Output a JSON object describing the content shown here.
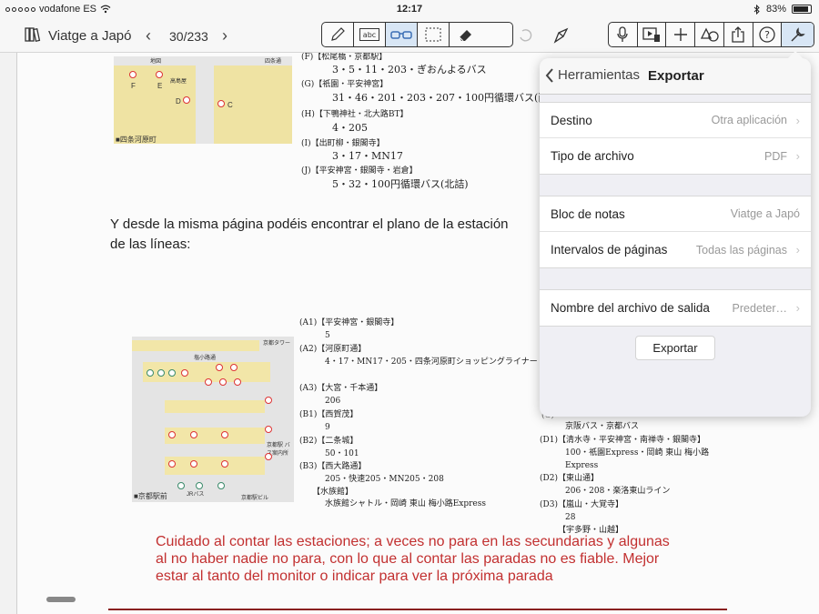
{
  "status": {
    "carrier": "vodafone ES",
    "time": "12:17",
    "battery": "83%"
  },
  "toolbar": {
    "doc_title": "Viatge a Japó",
    "page": "30/233",
    "prev_glyph": "‹",
    "next_glyph": "›"
  },
  "document": {
    "top_map": {
      "label_top": "地図",
      "label_corner": "四条通",
      "label_bottom": "■四条河原町",
      "stop_f": "F",
      "stop_e": "E",
      "stop_d": "D",
      "stop_c": "C",
      "landmark": "高島屋"
    },
    "top_routes": [
      {
        "head": "(F)【松尾橋・京都駅】",
        "body": "3・5・11・203・ぎおんよるバス"
      },
      {
        "head": "(G)【祇園・平安神宮】",
        "body": "31・46・201・203・207・100円循環バス(西詰)"
      },
      {
        "head": "(H)【下鴨神社・北大路BT】",
        "body": "4・205"
      },
      {
        "head": "(I)【出町柳・銀閣寺】",
        "body": "3・17・MN17"
      },
      {
        "head": "(J)【平安神宮・銀閣寺・岩倉】",
        "body": "5・32・100円循環バス(北詰)"
      }
    ],
    "paragraph_line1": "Y desde la misma página podéis encontrar el plano de la estación",
    "paragraph_line2": "de las líneas:",
    "bottom_map": {
      "label_top": "京都タワー",
      "label_bottom_left": "■京都駅前",
      "label_bottom_right": "京都駅ビル",
      "label_side": "京都駅 バス案内所",
      "label_street": "塩小路通",
      "label_jr": "JRバス"
    },
    "bottom_routes_left": [
      {
        "head": "(A1)【平安神宮・銀閣寺】",
        "body": "5"
      },
      {
        "head": "(A2)【河原町通】",
        "body": "4・17・MN17・205・四条河原町ショッピングライナー"
      },
      {
        "head": "(A3)【大宮・千本通】",
        "body": "206"
      },
      {
        "head": "(B1)【西賀茂】",
        "body": "9"
      },
      {
        "head": "(B2)【二条城】",
        "body": "50・101"
      },
      {
        "head": "(B3)【西大路通】",
        "body": "205・快速205・MN205・208"
      },
      {
        "head": "【水族館】",
        "body": "水族館シャトル・岡崎 東山 梅小路Express"
      }
    ],
    "bottom_routes_right": [
      {
        "head": "(C)",
        "body": "京阪バス・京都バス"
      },
      {
        "head": "(D1)【清水寺・平安神宮・南禅寺・銀閣寺】",
        "body": "100・祇園Express・岡崎 東山 梅小路 Express"
      },
      {
        "head": "(D2)【東山通】",
        "body": "206・208・楽洛東山ライン"
      },
      {
        "head": "(D3)【嵐山・大覚寺】",
        "body": "28"
      },
      {
        "head": "【宇多野・山越】",
        "body": ""
      }
    ],
    "note": "Cuidado al contar las estaciones; a veces no para en las secundarias y algunas al no haber nadie no para, con lo que al contar las paradas no es fiable. Mejor estar al tanto del monitor o indicar para ver la próxima parada"
  },
  "popover": {
    "back_label": "Herramientas",
    "title": "Exportar",
    "rows": [
      {
        "label": "Destino",
        "value": "Otra aplicación"
      },
      {
        "label": "Tipo de archivo",
        "value": "PDF"
      },
      {
        "label": "Bloc de notas",
        "value": "Viatge a Japó"
      },
      {
        "label": "Intervalos de páginas",
        "value": "Todas las páginas"
      },
      {
        "label": "Nombre del archivo de salida",
        "value": "Predeter…"
      }
    ],
    "export_button": "Exportar"
  },
  "colors": {
    "accent": "#3b6eb5",
    "note_red": "#c23030",
    "map_block": "#f2e6a8",
    "stop_red": "#dd3333"
  }
}
